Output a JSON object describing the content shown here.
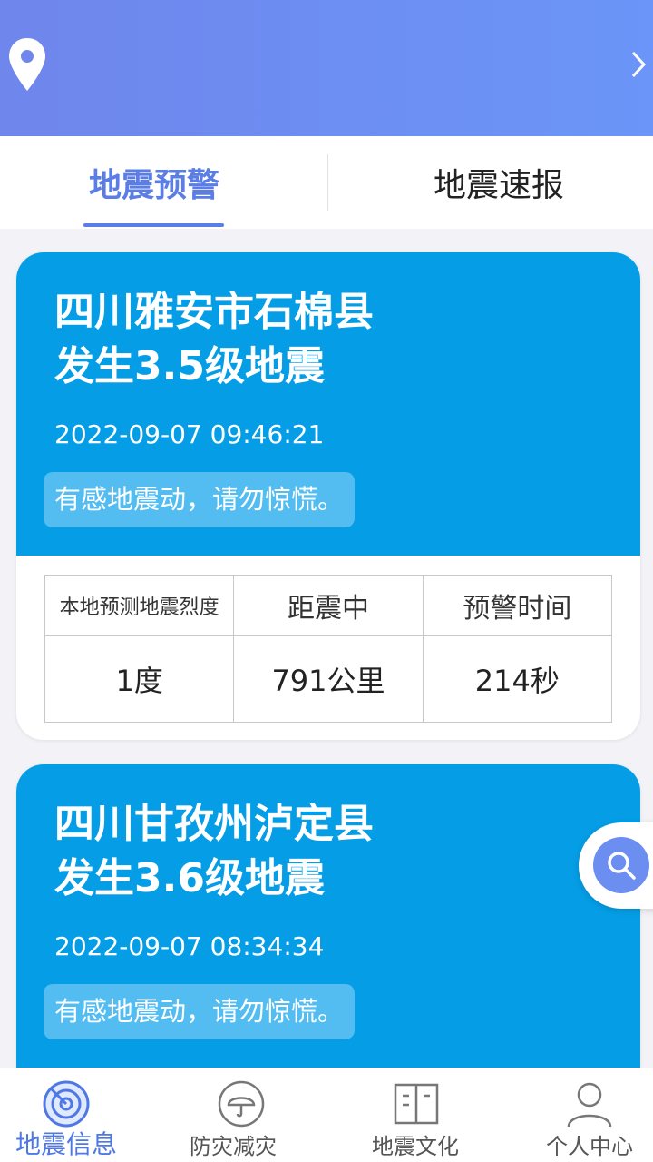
{
  "header": {
    "location_icon": "location-pin-icon",
    "chevron_icon": "chevron-right-icon"
  },
  "tabs": [
    {
      "label": "地震预警",
      "active": true
    },
    {
      "label": "地震速报",
      "active": false
    }
  ],
  "cards": [
    {
      "title_line1": "四川雅安市石棉县",
      "title_line2": "发生3.5级地震",
      "time": "2022-09-07 09:46:21",
      "notice": "有感地震动，请勿惊慌。",
      "table": {
        "headers": [
          "本地预测地震烈度",
          "距震中",
          "预警时间"
        ],
        "values": [
          "1度",
          "791公里",
          "214秒"
        ]
      }
    },
    {
      "title_line1": "四川甘孜州泸定县",
      "title_line2": "发生3.6级地震",
      "time": "2022-09-07 08:34:34",
      "notice": "有感地震动，请勿惊慌。"
    }
  ],
  "floating_button": {
    "icon": "search-icon"
  },
  "bottom_nav": [
    {
      "label": "地震信息",
      "icon": "radar-icon",
      "active": true
    },
    {
      "label": "防灾减灾",
      "icon": "umbrella-icon",
      "active": false
    },
    {
      "label": "地震文化",
      "icon": "book-icon",
      "active": false
    },
    {
      "label": "个人中心",
      "icon": "person-icon",
      "active": false
    }
  ],
  "colors": {
    "header": "#6b8ef0",
    "accent": "#5b7ee6",
    "card": "#059ee6",
    "notice": "#53bcf0"
  }
}
